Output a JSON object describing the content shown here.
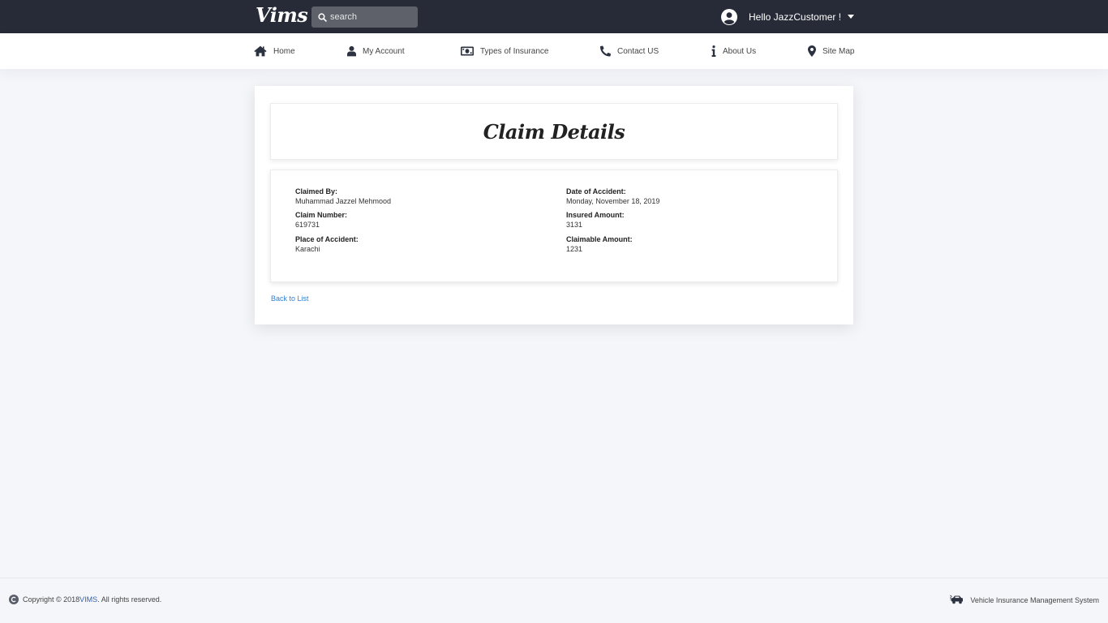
{
  "header": {
    "logo": "Vims",
    "search_placeholder": "search",
    "greeting": "Hello JazzCustomer !"
  },
  "nav": {
    "items": [
      {
        "label": "Home",
        "icon": "home-icon"
      },
      {
        "label": "My Account",
        "icon": "user-icon"
      },
      {
        "label": "Types of Insurance",
        "icon": "money-bill-icon"
      },
      {
        "label": "Contact US",
        "icon": "phone-icon"
      },
      {
        "label": "About Us",
        "icon": "info-icon"
      },
      {
        "label": "Site Map",
        "icon": "map-marker-icon"
      }
    ]
  },
  "main": {
    "title": "Claim Details",
    "fields": {
      "claimed_by": {
        "label": "Claimed By:",
        "value": "Muhammad Jazzel Mehmood"
      },
      "claim_number": {
        "label": "Claim Number:",
        "value": "619731"
      },
      "place_of_accident": {
        "label": "Place of Accident:",
        "value": "Karachi"
      },
      "date_of_accident": {
        "label": "Date of Accident:",
        "value": "Monday, November 18, 2019"
      },
      "insured_amount": {
        "label": "Insured Amount:",
        "value": "3131"
      },
      "claimable_amount": {
        "label": "Claimable Amount:",
        "value": "1231"
      }
    },
    "back_link": "Back to List"
  },
  "footer": {
    "copyright_prefix": "Copyright © 2018 ",
    "copyright_brand": "VIMS",
    "copyright_suffix": ". All rights reserved.",
    "system_name": "Vehicle Insurance Management System"
  },
  "colors": {
    "topbar": "#262b37",
    "background": "#f5f6fa",
    "link": "#2f7fd6"
  }
}
